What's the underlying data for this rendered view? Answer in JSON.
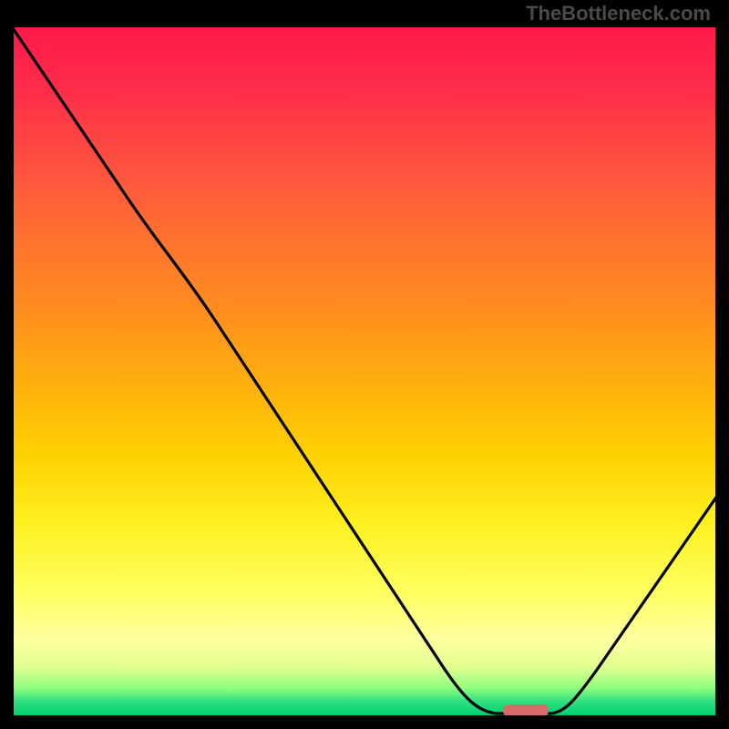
{
  "watermark": "TheBottleneck.com",
  "chart_data": {
    "type": "line",
    "title": "",
    "xlabel": "",
    "ylabel": "",
    "x_range": [
      0,
      100
    ],
    "y_range": [
      0,
      100
    ],
    "gradient_stops": [
      {
        "pos": 0,
        "color": "#ff1a4a"
      },
      {
        "pos": 50,
        "color": "#ffaa10"
      },
      {
        "pos": 82,
        "color": "#ffff60"
      },
      {
        "pos": 100,
        "color": "#00d070"
      }
    ],
    "curve": [
      {
        "x": 0,
        "y": 100
      },
      {
        "x": 20,
        "y": 70
      },
      {
        "x": 60,
        "y": 8
      },
      {
        "x": 69,
        "y": 0
      },
      {
        "x": 77,
        "y": 0
      },
      {
        "x": 100,
        "y": 32
      }
    ],
    "marker": {
      "x_center": 73,
      "y": 0,
      "color": "#d86a6a"
    }
  }
}
